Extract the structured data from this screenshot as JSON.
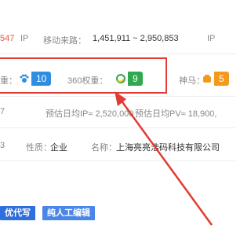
{
  "row1": {
    "ip_value": "547",
    "ip_unit": "IP",
    "mobile_label": "移动来路：",
    "mobile_range": "1,451,911 ~ 2,950,853",
    "mobile_unit": "IP"
  },
  "row2": {
    "weight_partial": "重：",
    "weight_value": "10",
    "so360_label": "360权重：",
    "so360_value": "9",
    "shenma_partial": "神马：",
    "shenma_value": "5"
  },
  "row3": {
    "partial": "7",
    "est_ip": "预估日均IP≈ 2,520,000",
    "est_pv": "预估日均PV≈ 18,900,"
  },
  "row4": {
    "partial": "3",
    "nature_label": "性质：",
    "nature_value": "企业",
    "name_label": "名称：",
    "name_value": "上海亮亮浩码科技有限公司"
  },
  "tags": {
    "tag1": "优代写",
    "tag2": "纯人工编辑"
  },
  "colors": {
    "accent_red": "#e03c33",
    "badge_blue": "#2f8ee0",
    "badge_green": "#2fa84f",
    "badge_orange": "#f39a1e",
    "tag_blue": "#2e6fdc"
  }
}
